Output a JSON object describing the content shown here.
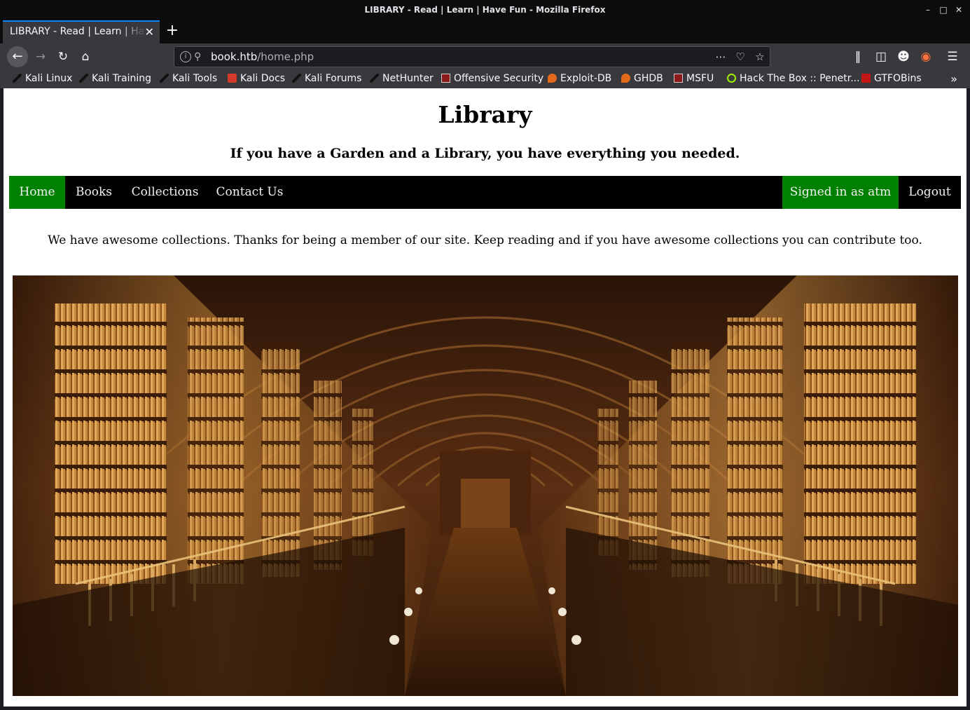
{
  "window": {
    "title": "LIBRARY - Read | Learn | Have Fun - Mozilla Firefox"
  },
  "tab": {
    "label": "LIBRARY - Read | Learn | Have Fun"
  },
  "urlbar": {
    "host": "book.htb",
    "path": "/home.php"
  },
  "bookmarks": [
    {
      "label": "Kali Linux",
      "icon": "kali-icon"
    },
    {
      "label": "Kali Training",
      "icon": "kali-icon"
    },
    {
      "label": "Kali Tools",
      "icon": "kali-icon"
    },
    {
      "label": "Kali Docs",
      "icon": "docs-icon"
    },
    {
      "label": "Kali Forums",
      "icon": "kali-icon"
    },
    {
      "label": "NetHunter",
      "icon": "kali-icon"
    },
    {
      "label": "Offensive Security",
      "icon": "offsec-icon"
    },
    {
      "label": "Exploit-DB",
      "icon": "exploitdb-icon"
    },
    {
      "label": "GHDB",
      "icon": "exploitdb-icon"
    },
    {
      "label": "MSFU",
      "icon": "offsec-icon"
    },
    {
      "label": "Hack The Box :: Penetr...",
      "icon": "htb-icon"
    },
    {
      "label": "GTFOBins",
      "icon": "gtfobins-icon"
    }
  ],
  "site": {
    "title": "Library",
    "tagline": "If you have a Garden and a Library, you have everything you needed.",
    "nav": {
      "home": "Home",
      "books": "Books",
      "collections": "Collections",
      "contact": "Contact Us",
      "signed_in": "Signed in as atm",
      "logout": "Logout"
    },
    "intro": "We have awesome collections. Thanks for being a member of our site. Keep reading and if you have awesome collections you can contribute too.",
    "hero_alt": "library hall photo"
  },
  "colors": {
    "nav_bg": "#000000",
    "nav_active": "#008000",
    "chrome_dark": "#0c0c0d",
    "chrome_toolbar": "#38383d",
    "tab_accent": "#0a84ff"
  }
}
